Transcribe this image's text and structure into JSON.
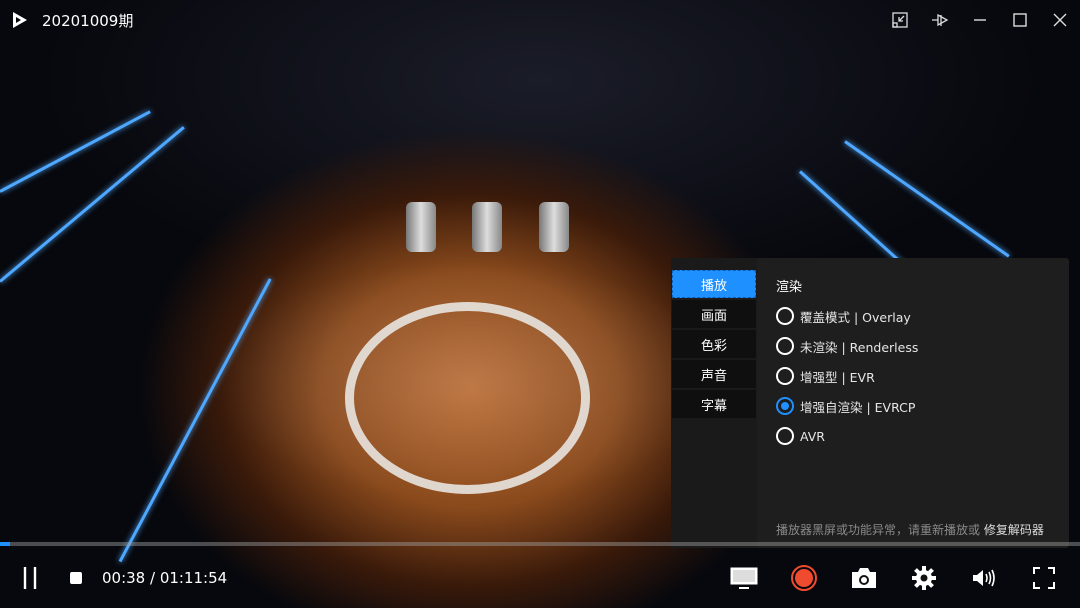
{
  "window": {
    "title": "20201009期"
  },
  "settings_panel": {
    "tabs": [
      "播放",
      "画面",
      "色彩",
      "声音",
      "字幕"
    ],
    "active_tab": 0,
    "section_title": "渲染",
    "options": [
      "覆盖模式 | Overlay",
      "未渲染 | Renderless",
      "增强型 | EVR",
      "增强自渲染 | EVRCP",
      "AVR"
    ],
    "selected_option": 3,
    "hint": "播放器黑屏或功能异常，请重新播放或",
    "hint_link": "修复解码器"
  },
  "player": {
    "time": "00:38 / 01:11:54",
    "progress_fraction": 0.009
  },
  "colors": {
    "accent": "#1e90ff",
    "record": "#f04a2f"
  }
}
